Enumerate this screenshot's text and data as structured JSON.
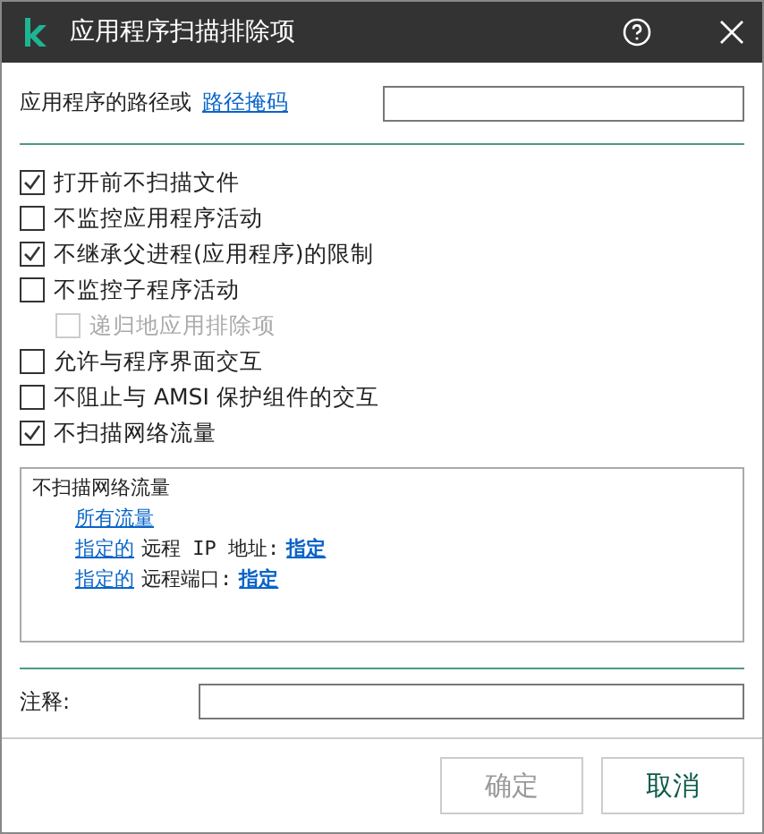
{
  "window": {
    "title": "应用程序扫描排除项"
  },
  "path": {
    "label": "应用程序的路径或",
    "link": "路径掩码"
  },
  "options": [
    {
      "label": "打开前不扫描文件",
      "checked": true,
      "disabled": false
    },
    {
      "label": "不监控应用程序活动",
      "checked": false,
      "disabled": false
    },
    {
      "label": "不继承父进程(应用程序)的限制",
      "checked": true,
      "disabled": false
    },
    {
      "label": "不监控子程序活动",
      "checked": false,
      "disabled": false,
      "children": [
        {
          "label": "递归地应用排除项",
          "checked": false,
          "disabled": true
        }
      ]
    },
    {
      "label": "允许与程序界面交互",
      "checked": false,
      "disabled": false
    },
    {
      "label": "不阻止与 AMSI 保护组件的交互",
      "checked": false,
      "disabled": false
    },
    {
      "label": "不扫描网络流量",
      "checked": true,
      "disabled": false
    }
  ],
  "description": {
    "title": "不扫描网络流量",
    "lines": [
      [
        {
          "kind": "link",
          "text": "所有流量",
          "bold": false
        }
      ],
      [
        {
          "kind": "link",
          "text": "指定的",
          "bold": false
        },
        {
          "kind": "text",
          "text": "远程 IP 地址:",
          "bold": false
        },
        {
          "kind": "link",
          "text": "指定",
          "bold": true
        }
      ],
      [
        {
          "kind": "link",
          "text": "指定的",
          "bold": false
        },
        {
          "kind": "text",
          "text": "远程端口:",
          "bold": false
        },
        {
          "kind": "link",
          "text": "指定",
          "bold": true
        }
      ]
    ]
  },
  "comment": {
    "label": "注释:"
  },
  "buttons": [
    {
      "label": "确定",
      "disabled": true
    },
    {
      "label": "取消",
      "disabled": false
    }
  ]
}
